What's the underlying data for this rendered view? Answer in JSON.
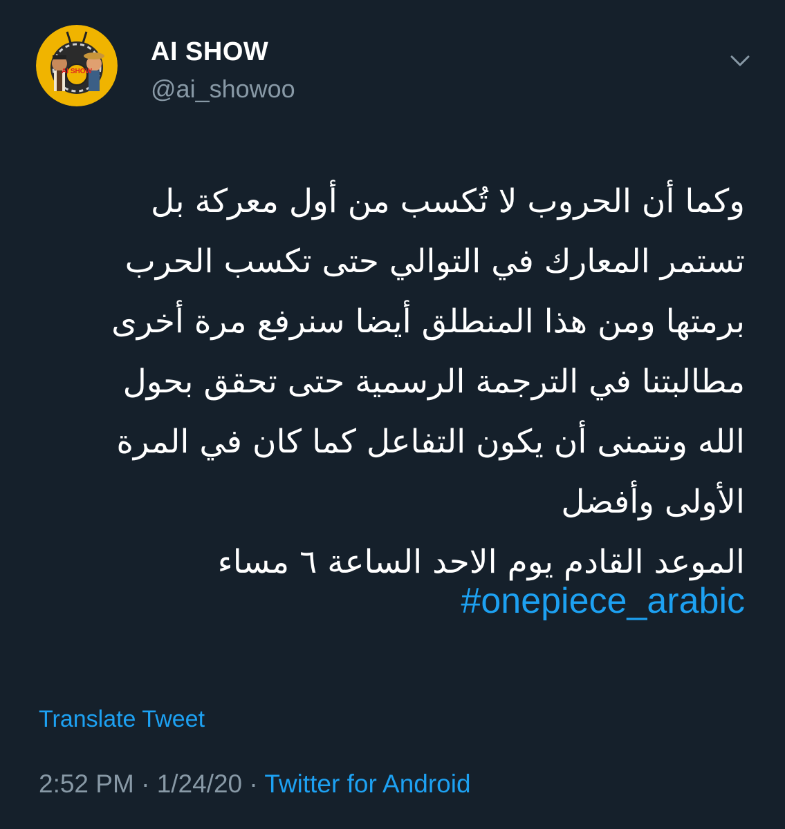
{
  "colors": {
    "background": "#15202b",
    "text": "#ffffff",
    "secondary": "#8899a6",
    "accent": "#1da1f2",
    "avatar_bg": "#f0b400"
  },
  "author": {
    "display_name": "AI SHOW",
    "handle": "@ai_showoo",
    "avatar_icon": "ai-show-logo",
    "avatar_logo_text": "AI SHOW"
  },
  "menu": {
    "icon": "chevron-down-icon"
  },
  "tweet": {
    "lines": [
      "وكما أن الحروب لا تُكسب من أول معركة بل",
      "تستمر المعارك في التوالي حتى تكسب الحرب",
      "برمتها ومن هذا المنطلق أيضا سنرفع مرة أخرى",
      "مطالبتنا في الترجمة الرسمية حتى تحقق بحول",
      "الله ونتمنى أن يكون التفاعل كما كان في المرة",
      "الأولى وأفضل",
      "الموعد القادم يوم الاحد الساعة ٦ مساء"
    ],
    "hashtag": "#onepiece_arabic"
  },
  "translate_label": "Translate Tweet",
  "meta": {
    "time": "2:52 PM",
    "separator1": " · ",
    "date": "1/24/20",
    "separator2": " · ",
    "source": "Twitter for Android"
  }
}
